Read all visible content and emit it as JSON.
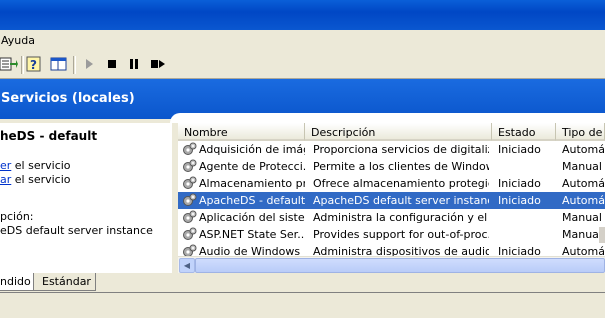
{
  "menu": {
    "ayuda": "Ayuda"
  },
  "header": {
    "title": "Servicios (locales)"
  },
  "left": {
    "service_title": "heDS - default",
    "link1_prefix": "er",
    "link1_suffix": " el servicio",
    "link2_prefix": "ar",
    "link2_suffix": " el servicio",
    "desc_label": "pción:",
    "desc_text": "eDS default server instance"
  },
  "columns": {
    "nombre": "Nombre",
    "descripcion": "Descripción",
    "estado": "Estado",
    "tipo": "Tipo de i"
  },
  "rows": [
    {
      "name": "Adquisición de imág...",
      "desc": "Proporciona servicios de digitaliza...",
      "state": "Iniciado",
      "type": "Automátic"
    },
    {
      "name": "Agente de Protecci...",
      "desc": "Permite a los clientes de Windows...",
      "state": "",
      "type": "Manual"
    },
    {
      "name": "Almacenamiento pr...",
      "desc": "Ofrece almacenamiento protegid...",
      "state": "Iniciado",
      "type": "Automátic"
    },
    {
      "name": "ApacheDS - default",
      "desc": "ApacheDS default server instance",
      "state": "Iniciado",
      "type": "Automátic"
    },
    {
      "name": "Aplicación del siste...",
      "desc": "Administra la configuración y el s...",
      "state": "",
      "type": "Manual"
    },
    {
      "name": "ASP.NET State Ser...",
      "desc": "Provides support for out-of-proc...",
      "state": "",
      "type": "Manual"
    },
    {
      "name": "Audio de Windows",
      "desc": "Administra dispositivos de audio p...",
      "state": "Iniciado",
      "type": "Automátic"
    }
  ],
  "tabs": {
    "extended": "ndido",
    "standard": "Estándar"
  },
  "colors": {
    "title_blue": "#0a57d0",
    "selection": "#316ac5",
    "link": "#0033cc"
  }
}
